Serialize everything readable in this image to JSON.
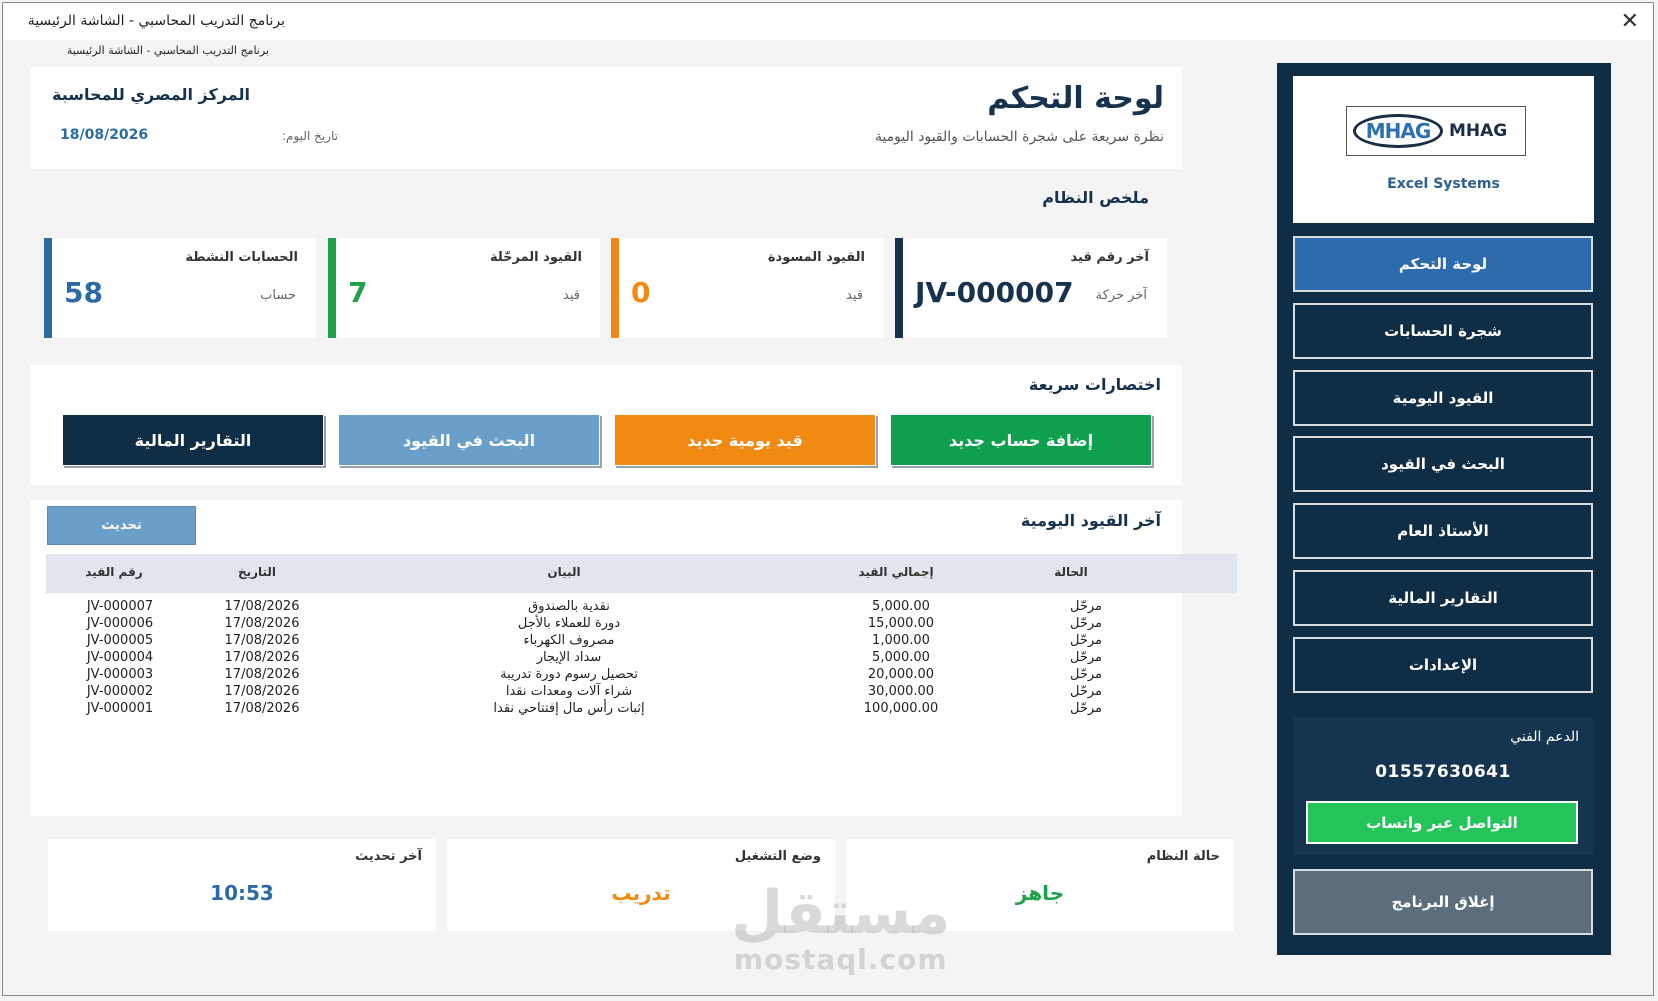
{
  "window": {
    "title": "برنامج التدريب المحاسبي - الشاشة الرئيسية",
    "subtitle": "برنامج التدريب المحاسبي - الشاشة الرئيسية",
    "close_glyph": "✕"
  },
  "header": {
    "title": "لوحة التحكم",
    "subtitle": "نظرة سريعة على شجرة الحسابات والقيود اليومية",
    "org": "المركز المصري للمحاسبة",
    "date_label": "تاريخ اليوم:",
    "date": "18/08/2026"
  },
  "summary": {
    "title": "ملخص النظام",
    "cards": [
      {
        "label": "آخر رقم قيد",
        "unit": "آخر حركة",
        "value": "JV-000007",
        "color": "#17324d"
      },
      {
        "label": "القيود المسودة",
        "unit": "قيد",
        "value": "0",
        "color": "#f08a12"
      },
      {
        "label": "القيود المرحّلة",
        "unit": "قيد",
        "value": "7",
        "color": "#20a04a"
      },
      {
        "label": "الحسابات النشطة",
        "unit": "حساب",
        "value": "58",
        "color": "#2c6aa6"
      }
    ]
  },
  "shortcuts": {
    "title": "اختصارات سريعة",
    "buttons": [
      {
        "label": "إضافة حساب جديد",
        "color": "#0ea04e"
      },
      {
        "label": "قيد يومية جديد",
        "color": "#f08a12"
      },
      {
        "label": "البحث في القيود",
        "color": "#6a9fc9"
      },
      {
        "label": "التقارير المالية",
        "color": "#0f2d45"
      }
    ]
  },
  "entries": {
    "title": "آخر القيود اليومية",
    "refresh_label": "تحديث",
    "columns": {
      "status": "الحالة",
      "total": "إجمالي القيد",
      "statement": "البيان",
      "date": "التاريخ",
      "number": "رقم القيد"
    },
    "rows": [
      {
        "status": "مرحّل",
        "total": "5,000.00",
        "statement": "نقدية بالصندوق",
        "date": "17/08/2026",
        "number": "JV-000007"
      },
      {
        "status": "مرحّل",
        "total": "15,000.00",
        "statement": "دورة للعملاء بالأجل",
        "date": "17/08/2026",
        "number": "JV-000006"
      },
      {
        "status": "مرحّل",
        "total": "1,000.00",
        "statement": "مصروف الكهرباء",
        "date": "17/08/2026",
        "number": "JV-000005"
      },
      {
        "status": "مرحّل",
        "total": "5,000.00",
        "statement": "سداد الإيجار",
        "date": "17/08/2026",
        "number": "JV-000004"
      },
      {
        "status": "مرحّل",
        "total": "20,000.00",
        "statement": "تحصيل رسوم دورة تدريبة",
        "date": "17/08/2026",
        "number": "JV-000003"
      },
      {
        "status": "مرحّل",
        "total": "30,000.00",
        "statement": "شراء آلات ومعدات نقدا",
        "date": "17/08/2026",
        "number": "JV-000002"
      },
      {
        "status": "مرحّل",
        "total": "100,000.00",
        "statement": "إثبات رأس مال إفتتاحي نقدا",
        "date": "17/08/2026",
        "number": "JV-000001"
      }
    ]
  },
  "status_bar": [
    {
      "label": "حالة النظام",
      "value": "جاهز",
      "color": "#20a04a"
    },
    {
      "label": "وضع التشغيل",
      "value": "تدريب",
      "color": "#f08a12"
    },
    {
      "label": "آخر تحديث",
      "value": "10:53",
      "color": "#2c6aa6"
    }
  ],
  "sidebar": {
    "logo_text": "MHAG",
    "logo_mark": "MHAG",
    "logo_caption": "Excel Systems",
    "nav": [
      {
        "label": "لوحة التحكم",
        "active": true
      },
      {
        "label": "شجرة الحسابات"
      },
      {
        "label": "القيود اليومية"
      },
      {
        "label": "البحث في القيود"
      },
      {
        "label": "الأستاذ العام"
      },
      {
        "label": "التقارير المالية"
      },
      {
        "label": "الإعدادات"
      }
    ],
    "support": {
      "label": "الدعم الفني",
      "phone": "01557630641",
      "whatsapp_label": "التواصل عبر واتساب"
    },
    "exit_label": "إغلاق البرنامج"
  },
  "watermark": {
    "arabic": "مستقل",
    "latin": "mostaql.com"
  }
}
